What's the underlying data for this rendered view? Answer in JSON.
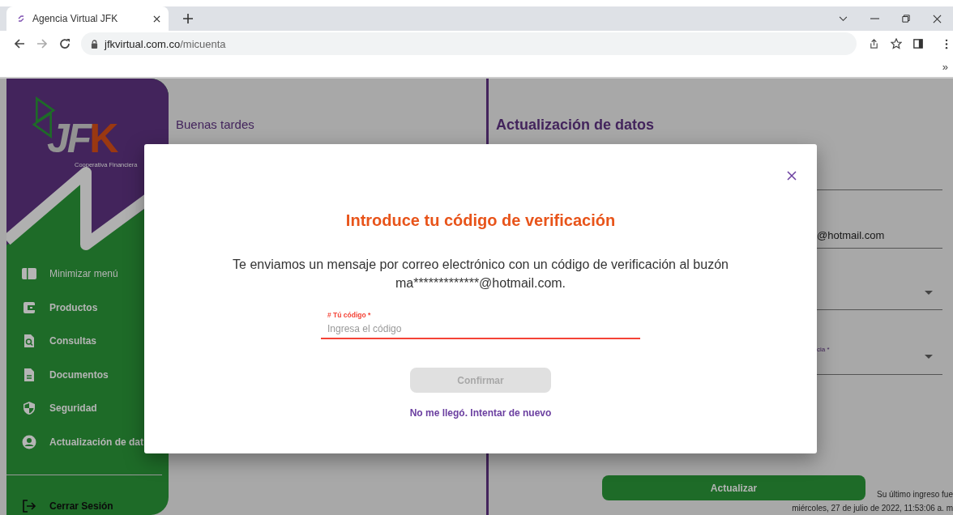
{
  "browser": {
    "tab": {
      "title": "Agencia Virtual JFK",
      "selected": true
    },
    "url_host": "jfkvirtual.com.co",
    "url_path": "/micuenta",
    "bookmarks_overflow": "»"
  },
  "sidebar": {
    "logo": {
      "mark": "JF",
      "accent": "K",
      "tagline": "Cooperativa Financiera"
    },
    "items": [
      {
        "label": "Minimizar menú",
        "kind": "panel"
      },
      {
        "label": "Productos",
        "kind": "wallet"
      },
      {
        "label": "Consultas",
        "kind": "search"
      },
      {
        "label": "Documentos",
        "kind": "doc"
      },
      {
        "label": "Seguridad",
        "kind": "shield"
      },
      {
        "label": "Actualización de dat",
        "kind": "user"
      }
    ],
    "logout": {
      "label": "Cerrar Sesión"
    }
  },
  "main": {
    "greeting": "Buenas tardes"
  },
  "form": {
    "title": "Actualización de datos",
    "fields": [
      {
        "kind": "text"
      },
      {
        "kind": "text",
        "value": "@hotmail.com"
      },
      {
        "kind": "select"
      },
      {
        "kind": "select",
        "label": "cia *"
      }
    ],
    "button": "Actualizar",
    "last_login": [
      "Su último ingreso fue",
      "miércoles, 27 de julio de 2022, 11:53:06 a. m"
    ]
  },
  "modal": {
    "title": "Introduce tu código de verificación",
    "message": "Te enviamos un mensaje por correo electrónico con un código de verificación al buzón ma*************@hotmail.com.",
    "field": {
      "label": "# Tú código *",
      "placeholder": "Ingresa el código",
      "invalid": true
    },
    "confirm": {
      "label": "Confirmar",
      "disabled": true
    },
    "resend": "No me llegó. Intentar de nuevo"
  }
}
